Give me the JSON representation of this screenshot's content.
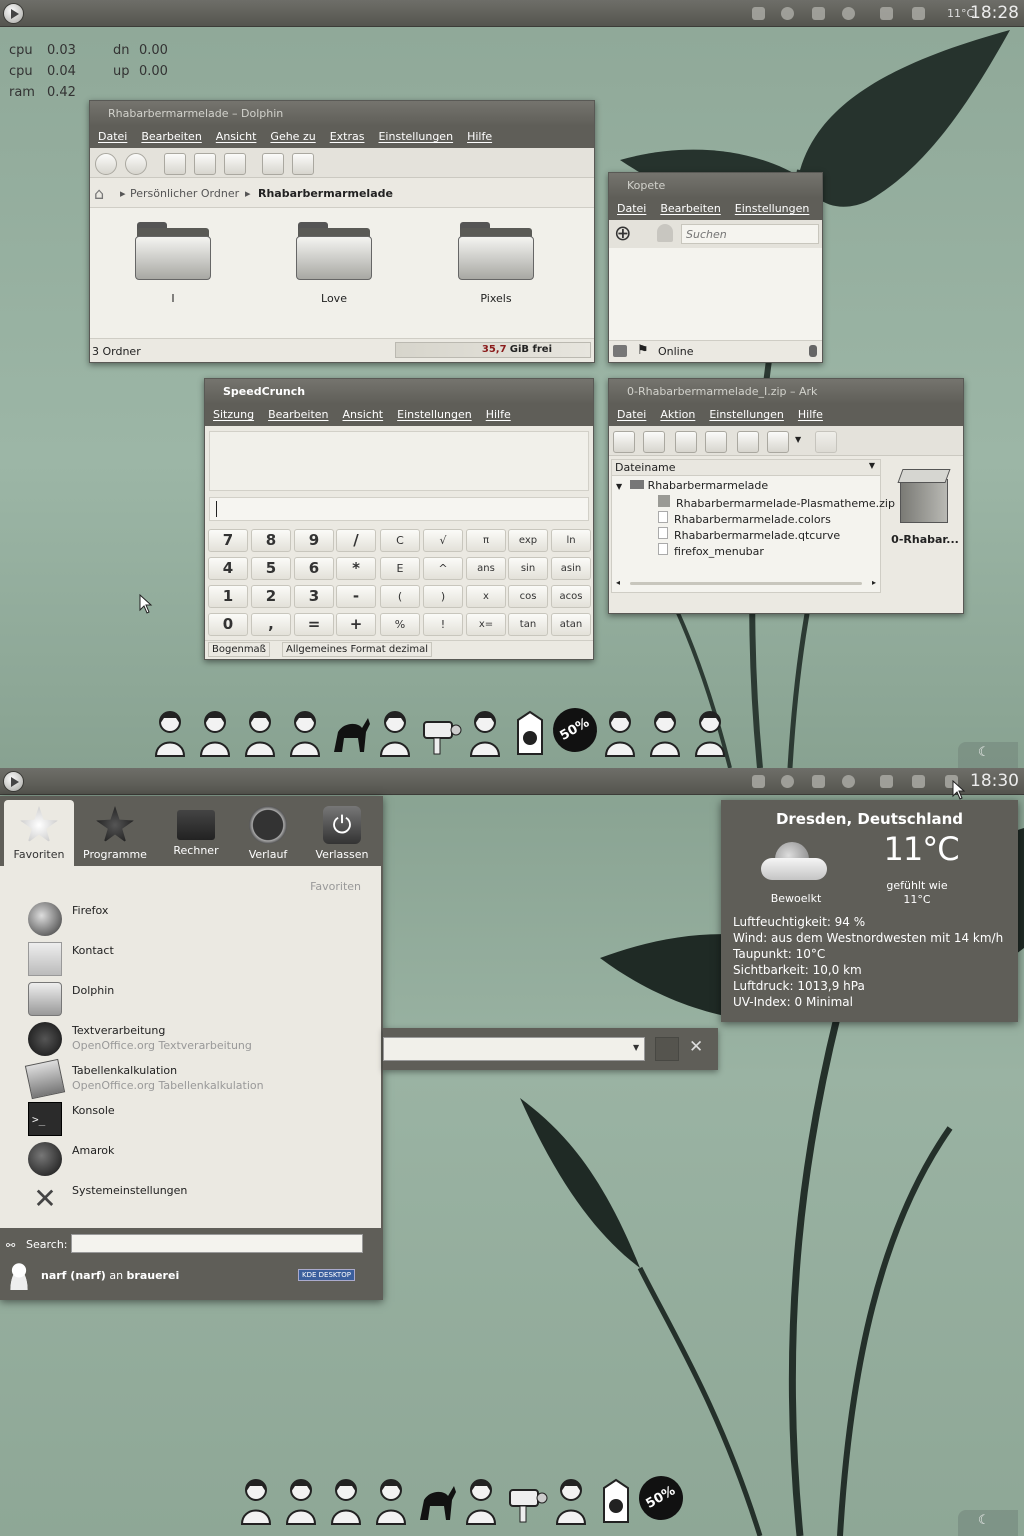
{
  "top": {
    "panel": {
      "clock": "18:28",
      "temp_label": "11°C"
    },
    "sysmon": {
      "cpu1_label": "cpu",
      "cpu1_value": "0.03",
      "cpu2_label": "cpu",
      "cpu2_value": "0.04",
      "ram_label": "ram",
      "ram_value": "0.42",
      "dn_label": "dn",
      "dn_value": "0.00",
      "up_label": "up",
      "up_value": "0.00"
    },
    "dolphin": {
      "title": "Rhabarbermarmelade – Dolphin",
      "menu": [
        "Datei",
        "Bearbeiten",
        "Ansicht",
        "Gehe zu",
        "Extras",
        "Einstellungen",
        "Hilfe"
      ],
      "breadcrumb_home": "Persönlicher Ordner",
      "breadcrumb_current": "Rhabarbermarmelade",
      "folders": [
        "I",
        "Love",
        "Pixels"
      ],
      "status": "3 Ordner",
      "free_value": "35,7",
      "free_unit": "GiB frei"
    },
    "kopete": {
      "title": "Kopete",
      "menu": [
        "Datei",
        "Bearbeiten",
        "Einstellungen"
      ],
      "search_placeholder": "Suchen",
      "status": "Online"
    },
    "speedcrunch": {
      "title": "SpeedCrunch",
      "menu": [
        "Sitzung",
        "Bearbeiten",
        "Ansicht",
        "Einstellungen",
        "Hilfe"
      ],
      "keys": [
        [
          "7",
          "8",
          "9",
          "/",
          "C",
          "√",
          "π",
          "exp",
          "ln"
        ],
        [
          "4",
          "5",
          "6",
          "*",
          "E",
          "^",
          "ans",
          "sin",
          "asin"
        ],
        [
          "1",
          "2",
          "3",
          "-",
          "(",
          ")",
          "x",
          "cos",
          "acos"
        ],
        [
          "0",
          ",",
          "=",
          "+",
          "%",
          "!",
          "x=",
          "tan",
          "atan"
        ]
      ],
      "status_angle": "Bogenmaß",
      "status_format": "Allgemeines Format dezimal"
    },
    "ark": {
      "title": "0-Rhabarbermarmelade_I.zip – Ark",
      "menu": [
        "Datei",
        "Aktion",
        "Einstellungen",
        "Hilfe"
      ],
      "column_header": "Dateiname",
      "root_folder": "Rhabarbermarmelade",
      "files": [
        "Rhabarbermarmelade-Plasmatheme.zip",
        "Rhabarbermarmelade.colors",
        "Rhabarbermarmelade.qtcurve",
        "firefox_menubar"
      ],
      "preview_label": "0-Rhabar..."
    },
    "dock_icons": [
      "portrait-icon",
      "girl-icon",
      "robot-icon",
      "astronaut-icon",
      "deer-icon",
      "nurse-icon",
      "camera-icon",
      "monkey-icon",
      "milk-icon",
      "sale-badge-icon",
      "crest-icon",
      "banana-icon",
      "bubble-icon"
    ],
    "sale_badge_text": "50%"
  },
  "bottom": {
    "panel": {
      "clock": "18:30"
    },
    "kickoff": {
      "tabs": [
        "Favoriten",
        "Programme",
        "Rechner",
        "Verlauf",
        "Verlassen"
      ],
      "section_header": "Favoriten",
      "items": [
        {
          "title": "Firefox",
          "subtitle": "",
          "icon": "firefox-icon"
        },
        {
          "title": "Kontact",
          "subtitle": "",
          "icon": "kontact-icon"
        },
        {
          "title": "Dolphin",
          "subtitle": "",
          "icon": "dolphin-icon"
        },
        {
          "title": "Textverarbeitung",
          "subtitle": "OpenOffice.org Textverarbeitung",
          "icon": "writer-icon"
        },
        {
          "title": "Tabellenkalkulation",
          "subtitle": "OpenOffice.org Tabellenkalkulation",
          "icon": "calc-icon"
        },
        {
          "title": "Konsole",
          "subtitle": "",
          "icon": "konsole-icon"
        },
        {
          "title": "Amarok",
          "subtitle": "",
          "icon": "amarok-icon"
        },
        {
          "title": "Systemeinstellungen",
          "subtitle": "",
          "icon": "settings-icon"
        }
      ],
      "search_label": "Search:",
      "search_value": "",
      "user_name": "narf (narf)",
      "user_at": "an",
      "host": "brauerei",
      "kde_badge": "KDE DESKTOP"
    },
    "weather": {
      "location": "Dresden, Deutschland",
      "temperature": "11°C",
      "condition": "Bewoelkt",
      "feels_like_label": "gefühlt wie",
      "feels_like_value": "11°C",
      "details": [
        "Luftfeuchtigkeit: 94 %",
        "Wind: aus dem Westnordwesten mit 14 km/h",
        "Taupunkt: 10°C",
        "Sichtbarkeit: 10,0 km",
        "Luftdruck: 1013,9 hPa",
        "UV-Index: 0 Minimal"
      ]
    },
    "runner_value": "",
    "dock_icons": [
      "portrait-icon",
      "girl-icon",
      "robot-icon",
      "astronaut-icon",
      "deer-icon",
      "nurse-icon",
      "camera-icon",
      "monkey-icon",
      "milk-icon",
      "sale-badge-icon"
    ],
    "sale_badge_text": "50%"
  }
}
